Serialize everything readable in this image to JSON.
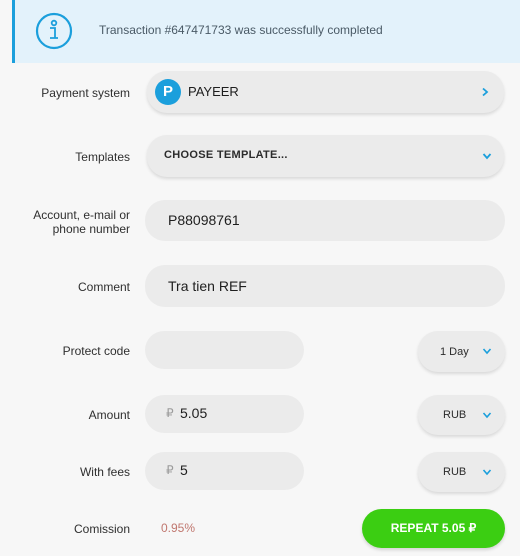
{
  "alert": {
    "message": "Transaction #647471733 was successfully completed"
  },
  "form": {
    "payment_system": {
      "label": "Payment system",
      "value": "PAYEER",
      "logo_letter": "P"
    },
    "templates": {
      "label": "Templates",
      "value": "CHOOSE TEMPLATE..."
    },
    "account": {
      "label_line1": "Account, e-mail or",
      "label_line2": "phone number",
      "value": "P88098761"
    },
    "comment": {
      "label": "Comment",
      "value": "Tra tien REF"
    },
    "protect_code": {
      "label": "Protect code",
      "value": "",
      "period": "1 Day"
    },
    "amount": {
      "label": "Amount",
      "currency_symbol": "₽",
      "value": "5.05",
      "currency": "RUB"
    },
    "with_fees": {
      "label": "With fees",
      "currency_symbol": "₽",
      "value": "5",
      "currency": "RUB"
    },
    "commission": {
      "label": "Comission",
      "value": "0.95%"
    }
  },
  "actions": {
    "repeat_label": "REPEAT 5.05 ₽"
  },
  "colors": {
    "accent": "#1b9fdc",
    "success": "#3bce12",
    "fee": "#c0776f"
  }
}
